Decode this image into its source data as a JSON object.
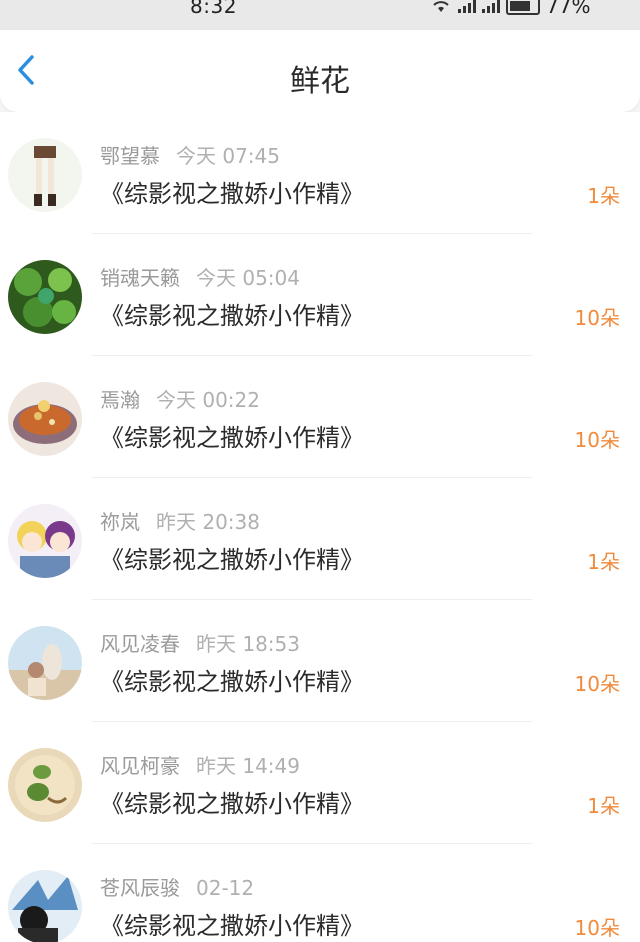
{
  "status": {
    "time": "8:32",
    "battery": "77%"
  },
  "header": {
    "title": "鲜花",
    "back_icon": "chevron-left-icon"
  },
  "colors": {
    "accent": "#2a8fe0",
    "flower_count": "#f08a3c",
    "meta": "#9a9a9a"
  },
  "records": [
    {
      "user": "鄂望慕",
      "time": "今天 07:45",
      "book": "《综影视之撒娇小作精》",
      "count": "1朵"
    },
    {
      "user": "销魂天籁",
      "time": "今天 05:04",
      "book": "《综影视之撒娇小作精》",
      "count": "10朵"
    },
    {
      "user": "焉瀚",
      "time": "今天 00:22",
      "book": "《综影视之撒娇小作精》",
      "count": "10朵"
    },
    {
      "user": "祢岚",
      "time": "昨天 20:38",
      "book": "《综影视之撒娇小作精》",
      "count": "1朵"
    },
    {
      "user": "风见凌春",
      "time": "昨天 18:53",
      "book": "《综影视之撒娇小作精》",
      "count": "10朵"
    },
    {
      "user": "风见柯豪",
      "time": "昨天 14:49",
      "book": "《综影视之撒娇小作精》",
      "count": "1朵"
    },
    {
      "user": "苍风辰骏",
      "time": "02-12",
      "book": "《综影视之撒娇小作精》",
      "count": "10朵"
    }
  ]
}
